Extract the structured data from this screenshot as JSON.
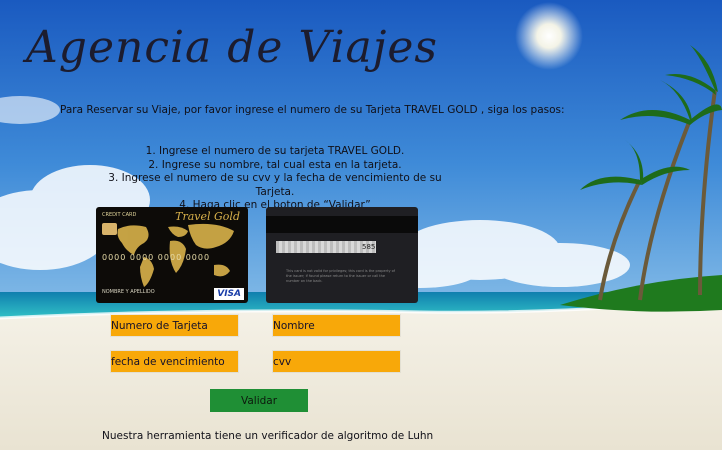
{
  "header": {
    "title": "Agencia de Viajes",
    "intro": "Para Reservar su Viaje, por favor ingrese el numero de su Tarjeta TRAVEL GOLD , siga los pasos:"
  },
  "steps": [
    "1.  Ingrese el numero de su tarjeta TRAVEL GOLD.",
    "2.  Ingrese su nombre, tal cual esta en la tarjeta.",
    "3.  Ingrese el numero de su cvv y la fecha de vencimiento de su Tarjeta.",
    "4. Haga clic en el boton de “Validar”"
  ],
  "card_front": {
    "label": "CREDIT CARD",
    "brand": "Travel Gold",
    "digits": "0000 0000 0000 0000",
    "holder": "NOMBRE Y APELLIDO",
    "network": "VISA"
  },
  "card_back": {
    "cvv": "585",
    "fine_print": "This card is not valid for privileges; this card is the property of the issuer; if found please return to the issuer or call the number on the back."
  },
  "form": {
    "card_number_placeholder": "Numero de Tarjeta",
    "name_placeholder": "Nombre",
    "expiry_placeholder": "fecha de vencimiento",
    "cvv_placeholder": "cvv",
    "submit_label": "Validar"
  },
  "footer": {
    "note": "Nuestra herramienta tiene un verificador de algoritmo de Luhn"
  },
  "colors": {
    "field": "#f8a809",
    "button": "#1f8f35",
    "sky": "#2a6fd1",
    "sea": "#19a8c8",
    "sand": "#f1ede1"
  },
  "icons": {
    "sun": "sun-icon",
    "palm": "palm-tree-icon",
    "chip": "chip-icon",
    "world": "world-map-icon"
  }
}
